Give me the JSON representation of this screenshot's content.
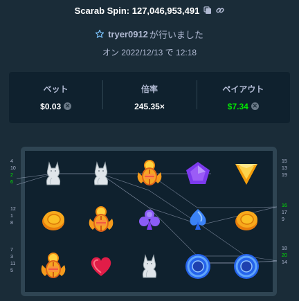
{
  "header": {
    "title": "Scarab Spin: 127,046,953,491",
    "copy_icon": "copy-icon",
    "link_icon": "link-icon"
  },
  "user": {
    "icon": "star-badge-icon",
    "name": "tryer0912",
    "suffix": "が行いました"
  },
  "date": "オン 2022/12/13 で 12:18",
  "stats": {
    "bet_label": "ベット",
    "bet_value": "$0.03",
    "multiplier_label": "倍率",
    "multiplier_value": "245.35×",
    "payout_label": "ペイアウト",
    "payout_value": "$7.34",
    "currency_icon": "coin-icon",
    "payout_color": "#00e701"
  },
  "board": {
    "left_numbers": [
      [
        "4",
        "10",
        "2",
        "6"
      ],
      [
        "12",
        "1",
        "8"
      ],
      [
        "7",
        "3",
        "11",
        "5"
      ]
    ],
    "right_numbers": [
      [
        "15",
        "13",
        "19"
      ],
      [
        "16",
        "17",
        "9"
      ],
      [
        "18",
        "20",
        "14"
      ]
    ],
    "left_highlight": [
      "2",
      "6"
    ],
    "right_highlight": [
      "16",
      "20"
    ],
    "highlight_color": "#00e701",
    "grid": [
      [
        "cat-statue",
        "cat-statue",
        "scarab",
        "pentagon-gem",
        "triangle-gem"
      ],
      [
        "coin",
        "scarab",
        "club",
        "spade",
        "coin"
      ],
      [
        "scarab",
        "heart",
        "cat-statue",
        "blue-orb",
        "blue-orb"
      ]
    ]
  }
}
